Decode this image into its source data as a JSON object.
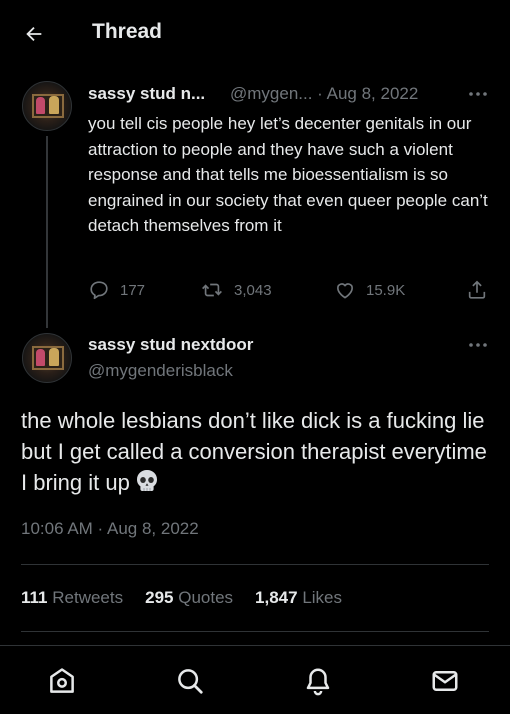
{
  "header": {
    "title": "Thread"
  },
  "tweets": [
    {
      "author_name": "sassy stud n...",
      "meta": "@mygen... · Aug 8, 2022",
      "text": "you tell cis people hey let’s decenter genitals in our attraction to people and they have such a violent response and that tells me bioessentialism is so engrained in our society that even queer people can’t detach themselves from it",
      "replies": "177",
      "retweets": "3,043",
      "likes": "15.9K"
    },
    {
      "author_name": "sassy stud nextdoor",
      "handle": "@mygenderisblack",
      "text": "the whole lesbians don’t like dick is a fucking lie but I get called a conversion therapist everytime I bring it up",
      "emoji": "skull",
      "timestamp": "10:06 AM · Aug 8, 2022",
      "stats": {
        "retweets_count": "111",
        "retweets_label": "Retweets",
        "quotes_count": "295",
        "quotes_label": "Quotes",
        "likes_count": "1,847",
        "likes_label": "Likes"
      }
    }
  ],
  "bottom_nav": [
    "home-icon",
    "search-icon",
    "notifications-icon",
    "messages-icon"
  ],
  "colors": {
    "background": "#000000",
    "text": "#e7e9ea",
    "muted": "#71767b",
    "divider": "#2f3336"
  }
}
